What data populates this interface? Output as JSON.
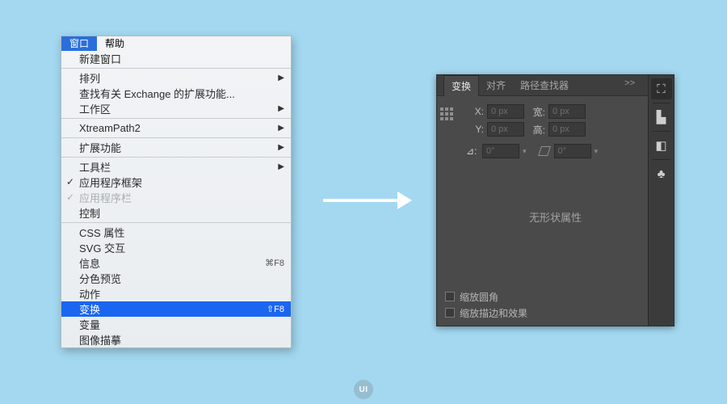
{
  "menubar": {
    "window": "窗口",
    "help": "帮助"
  },
  "menu": {
    "new_window": "新建窗口",
    "arrange": "排列",
    "find_ext": "查找有关 Exchange 的扩展功能...",
    "workspace": "工作区",
    "xtreampath": "XtreamPath2",
    "extensions": "扩展功能",
    "toolbar": "工具栏",
    "app_frame": "应用程序框架",
    "app_bar": "应用程序栏",
    "control": "控制",
    "css_props": "CSS 属性",
    "svg_interact": "SVG 交互",
    "info": "信息",
    "info_shortcut": "⌘F8",
    "sep_preview": "分色预览",
    "actions": "动作",
    "transform": "变换",
    "transform_shortcut": "⇧F8",
    "variables": "变量",
    "image_trace": "图像描摹"
  },
  "panel": {
    "tabs": {
      "transform": "变换",
      "align": "对齐",
      "pathfinder": "路径查找器"
    },
    "more": ">>",
    "menu_glyph": "| ≡",
    "x_label": "X:",
    "y_label": "Y:",
    "w_label": "宽:",
    "h_label": "高:",
    "x_val": "0 px",
    "y_val": "0 px",
    "w_val": "0 px",
    "h_val": "0 px",
    "angle_label": "⊿:",
    "angle_val": "0°",
    "shear_val": "0°",
    "link_glyph": "⛓",
    "no_shape": "无形状属性",
    "cb_round": "缩放圆角",
    "cb_stroke": "缩放描边和效果",
    "tool1": "⛶",
    "tool2": "▙",
    "tool3": "◧",
    "tool4": "♣"
  },
  "watermark": "UI"
}
